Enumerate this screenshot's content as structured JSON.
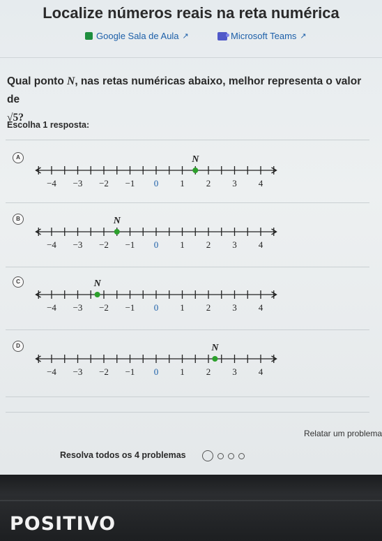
{
  "header": {
    "title": "Localize números reais na reta numérica",
    "links": [
      {
        "label": "Google Sala de Aula",
        "icon": "google-classroom-icon"
      },
      {
        "label": "Microsoft Teams",
        "icon": "microsoft-teams-icon"
      }
    ]
  },
  "question": {
    "text_before": "Qual ponto",
    "variable": "N",
    "text_after": ", nas retas numéricas abaixo, melhor representa o valor de",
    "expression": "√5?"
  },
  "instruction": "Escolha 1 resposta:",
  "options": [
    {
      "letter": "A",
      "point_label": "N",
      "point_value": 1.5
    },
    {
      "letter": "B",
      "point_label": "N",
      "point_value": -1.5
    },
    {
      "letter": "C",
      "point_label": "N",
      "point_value": -2.25
    },
    {
      "letter": "D",
      "point_label": "N",
      "point_value": 2.25
    }
  ],
  "number_line": {
    "tick_labels": [
      "−4",
      "−3",
      "−2",
      "−1",
      "0",
      "1",
      "2",
      "3",
      "4"
    ],
    "zero_color": "#1c5fa8",
    "point_color": "#2ca02c"
  },
  "footer": {
    "report_label": "Relatar um problema",
    "progress_text": "Resolva todos os 4 problemas",
    "progress_steps": 4,
    "progress_current": 1
  },
  "device": {
    "brand": "POSITIVO"
  }
}
